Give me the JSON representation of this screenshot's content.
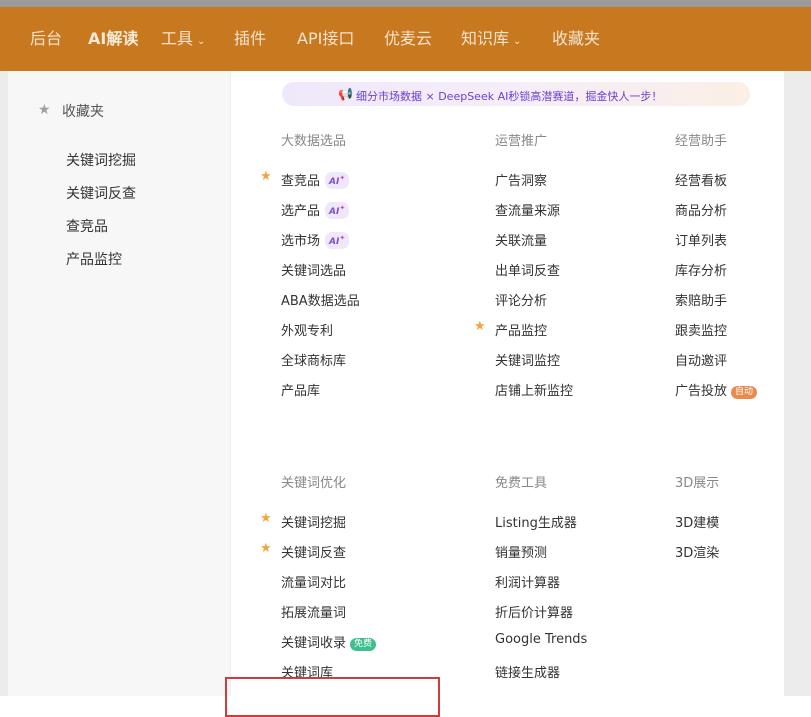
{
  "nav": {
    "items": [
      {
        "label": "后台"
      },
      {
        "label": "AI解读"
      },
      {
        "label": "工具"
      },
      {
        "label": "插件"
      },
      {
        "label": "API接口"
      },
      {
        "label": "优麦云"
      },
      {
        "label": "知识库"
      },
      {
        "label": "收藏夹"
      }
    ]
  },
  "sidebar": {
    "title": "收藏夹",
    "items": [
      "关键词挖掘",
      "关键词反查",
      "查竞品",
      "产品监控"
    ]
  },
  "banner": {
    "text": "细分市场数据 × DeepSeek AI秒锁高潜赛道，掘金快人一步！"
  },
  "badges": {
    "ai": "AI",
    "auto": "自动",
    "free": "免费"
  },
  "sections": {
    "big_data": {
      "title": "大数据选品",
      "items": [
        "查竞品",
        "选产品",
        "选市场",
        "关键词选品",
        "ABA数据选品",
        "外观专利",
        "全球商标库",
        "产品库"
      ]
    },
    "operations": {
      "title": "运营推广",
      "items": [
        "广告洞察",
        "查流量来源",
        "关联流量",
        "出单词反查",
        "评论分析",
        "产品监控",
        "关键词监控",
        "店铺上新监控"
      ]
    },
    "assistant": {
      "title": "经营助手",
      "items": [
        "经营看板",
        "商品分析",
        "订单列表",
        "库存分析",
        "索赔助手",
        "跟卖监控",
        "自动邀评",
        "广告投放"
      ]
    },
    "keyword_opt": {
      "title": "关键词优化",
      "items": [
        "关键词挖掘",
        "关键词反查",
        "流量词对比",
        "拓展流量词",
        "关键词收录",
        "关键词库"
      ]
    },
    "free_tools": {
      "title": "免费工具",
      "items": [
        "Listing生成器",
        "销量预测",
        "利润计算器",
        "折后价计算器",
        "Google Trends",
        "链接生成器"
      ]
    },
    "display3d": {
      "title": "3D展示",
      "items": [
        "3D建模",
        "3D渲染"
      ]
    }
  },
  "colors": {
    "nav_bg": "#c8781f",
    "star": "#f2a53a",
    "ai_purple": "#7b4fd6",
    "highlight_box": "#d23b3b"
  }
}
